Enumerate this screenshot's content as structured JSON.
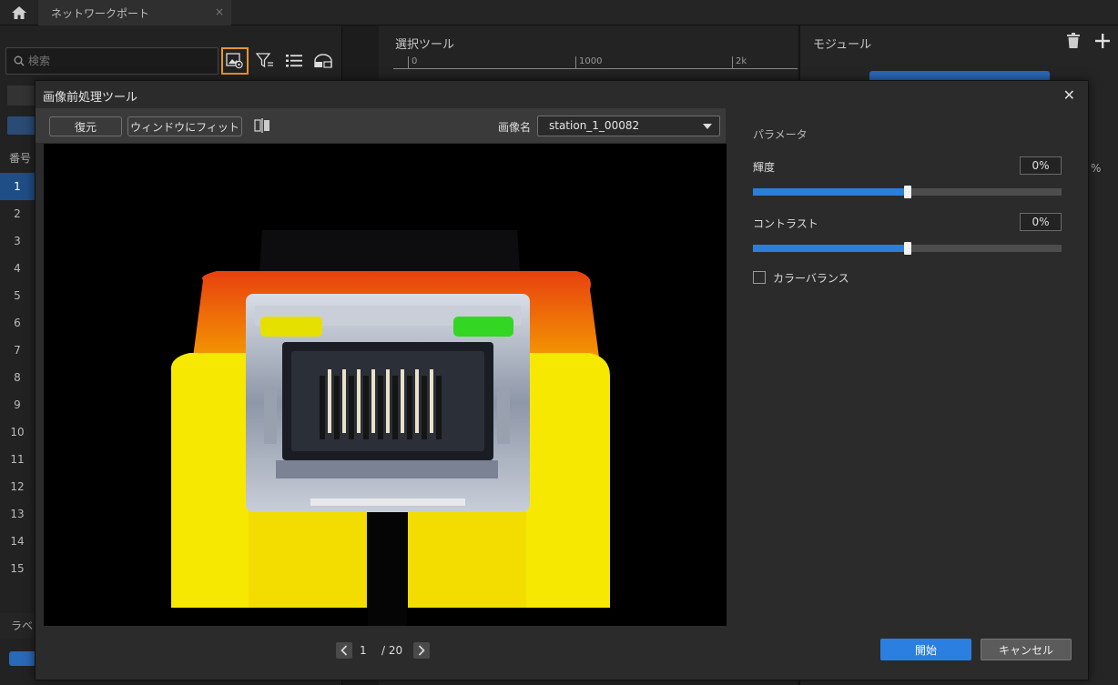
{
  "tabs": {
    "document_tab": "ネットワークポート"
  },
  "left_panel": {
    "search_placeholder": "検索",
    "table_header": "番号",
    "rows": [
      "1",
      "2",
      "3",
      "4",
      "5",
      "6",
      "7",
      "8",
      "9",
      "10",
      "11",
      "12",
      "13",
      "14",
      "15"
    ],
    "selected_row": "1",
    "bottom_tab": "ラベ"
  },
  "middle_panel": {
    "title": "選択ツール",
    "ruler": [
      "0",
      "1000",
      "2k"
    ]
  },
  "right_panel": {
    "title": "モジュール",
    "edge_text": "%"
  },
  "modal": {
    "title": "画像前処理ツール",
    "toolbar": {
      "restore_label": "復元",
      "fit_window_label": "ウィンドウにフィット",
      "image_name_label": "画像名",
      "image_name_value": "station_1_00082"
    },
    "pager": {
      "current": "1",
      "total": "/ 20"
    },
    "params": {
      "title": "パラメータ",
      "brightness_label": "輝度",
      "brightness_value": "0%",
      "brightness_level": 0.5,
      "contrast_label": "コントラスト",
      "contrast_value": "0%",
      "contrast_level": 0.5,
      "color_balance_label": "カラーバランス",
      "color_balance_checked": false
    },
    "buttons": {
      "start": "開始",
      "cancel": "キャンセル"
    }
  },
  "colors": {
    "accent": "#2a7fe0",
    "highlight": "#e8962b",
    "connector_yellow": "#f5e600",
    "connector_orange": "#f05a1a"
  }
}
